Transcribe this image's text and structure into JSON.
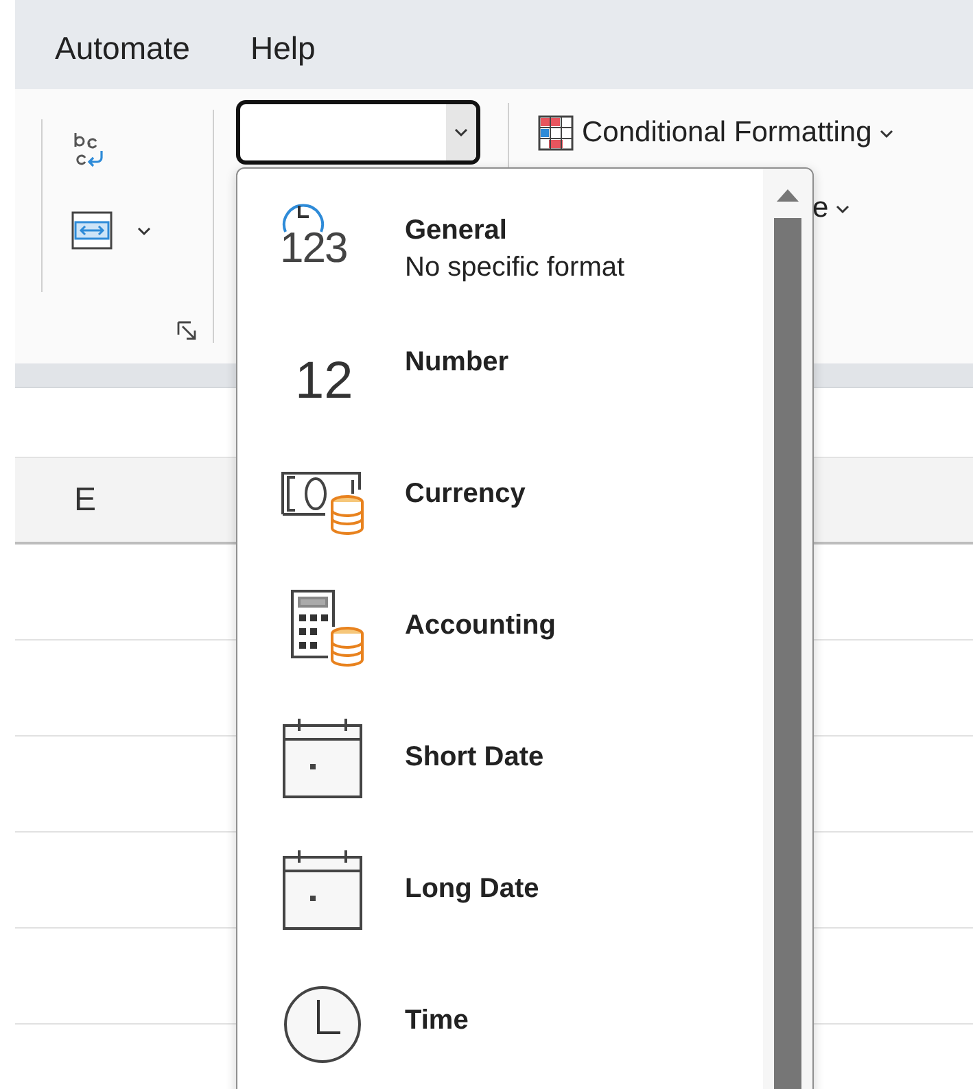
{
  "menu_tabs": [
    {
      "label": "Automate"
    },
    {
      "label": "Help"
    }
  ],
  "ribbon": {
    "conditional_formatting": {
      "label": "Conditional Formatting"
    },
    "partly_hidden_button": {
      "label": "e"
    }
  },
  "sheet": {
    "column_headers": [
      "E"
    ]
  },
  "format_menu": {
    "items": [
      {
        "kind": "general",
        "label": "General",
        "description": "No specific format",
        "icon_text": "123"
      },
      {
        "kind": "number",
        "label": "Number",
        "icon_text": "12"
      },
      {
        "kind": "currency",
        "label": "Currency"
      },
      {
        "kind": "accounting",
        "label": "Accounting"
      },
      {
        "kind": "date",
        "label": "Short Date"
      },
      {
        "kind": "date",
        "label": "Long Date"
      },
      {
        "kind": "time",
        "label": "Time"
      }
    ]
  }
}
